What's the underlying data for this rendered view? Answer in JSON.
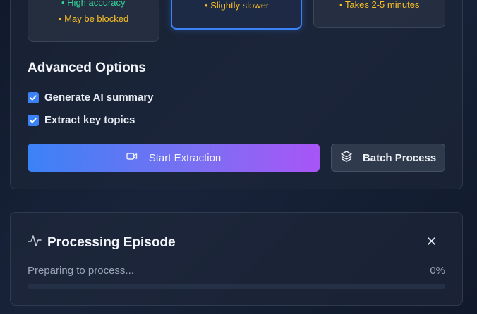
{
  "method_cards": {
    "left": {
      "notes": [
        "• High accuracy",
        "• May be blocked"
      ]
    },
    "middle": {
      "notes": [
        "• Slightly slower"
      ]
    },
    "right": {
      "notes": [
        "• Takes 2-5 minutes"
      ]
    }
  },
  "advanced_options": {
    "title": "Advanced Options",
    "options": [
      {
        "label": "Generate AI summary",
        "checked": true
      },
      {
        "label": "Extract key topics",
        "checked": true
      }
    ]
  },
  "actions": {
    "start_label": "Start Extraction",
    "start_icon": "video-icon",
    "batch_label": "Batch Process",
    "batch_icon": "layers-icon"
  },
  "processing": {
    "title": "Processing Episode",
    "icon": "activity-icon",
    "status": "Preparing to process...",
    "percent_label": "0%",
    "progress": 0,
    "close_icon": "close-icon"
  },
  "colors": {
    "accent": "#3b82f6",
    "gradient_end": "#a855f7",
    "success": "#34d399",
    "warning": "#fbbf24"
  }
}
